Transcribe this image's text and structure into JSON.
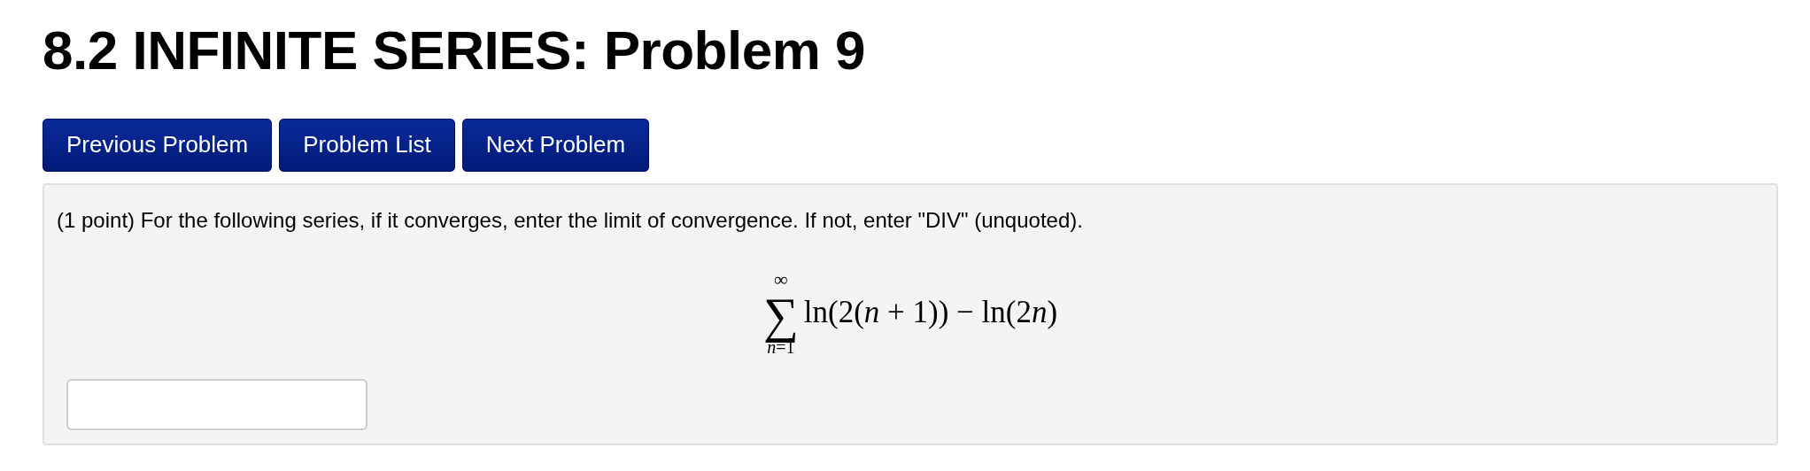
{
  "title": "8.2 INFINITE SERIES: Problem 9",
  "nav_buttons": [
    {
      "label": "Previous Problem"
    },
    {
      "label": "Problem List"
    },
    {
      "label": "Next Problem"
    }
  ],
  "problem": {
    "prompt": "(1 point) For the following series, if it converges, enter the limit of convergence. If not, enter \"DIV\" (unquoted).",
    "formula": {
      "operator": "∑",
      "upper": "∞",
      "lower": [
        {
          "text": "n",
          "italic": true
        },
        {
          "text": "=1",
          "italic": false
        }
      ],
      "expression": [
        {
          "text": "ln(2(",
          "italic": false
        },
        {
          "text": "n",
          "italic": true
        },
        {
          "text": " + 1)) − ln(2",
          "italic": false
        },
        {
          "text": "n",
          "italic": true
        },
        {
          "text": ")",
          "italic": false
        }
      ]
    }
  }
}
